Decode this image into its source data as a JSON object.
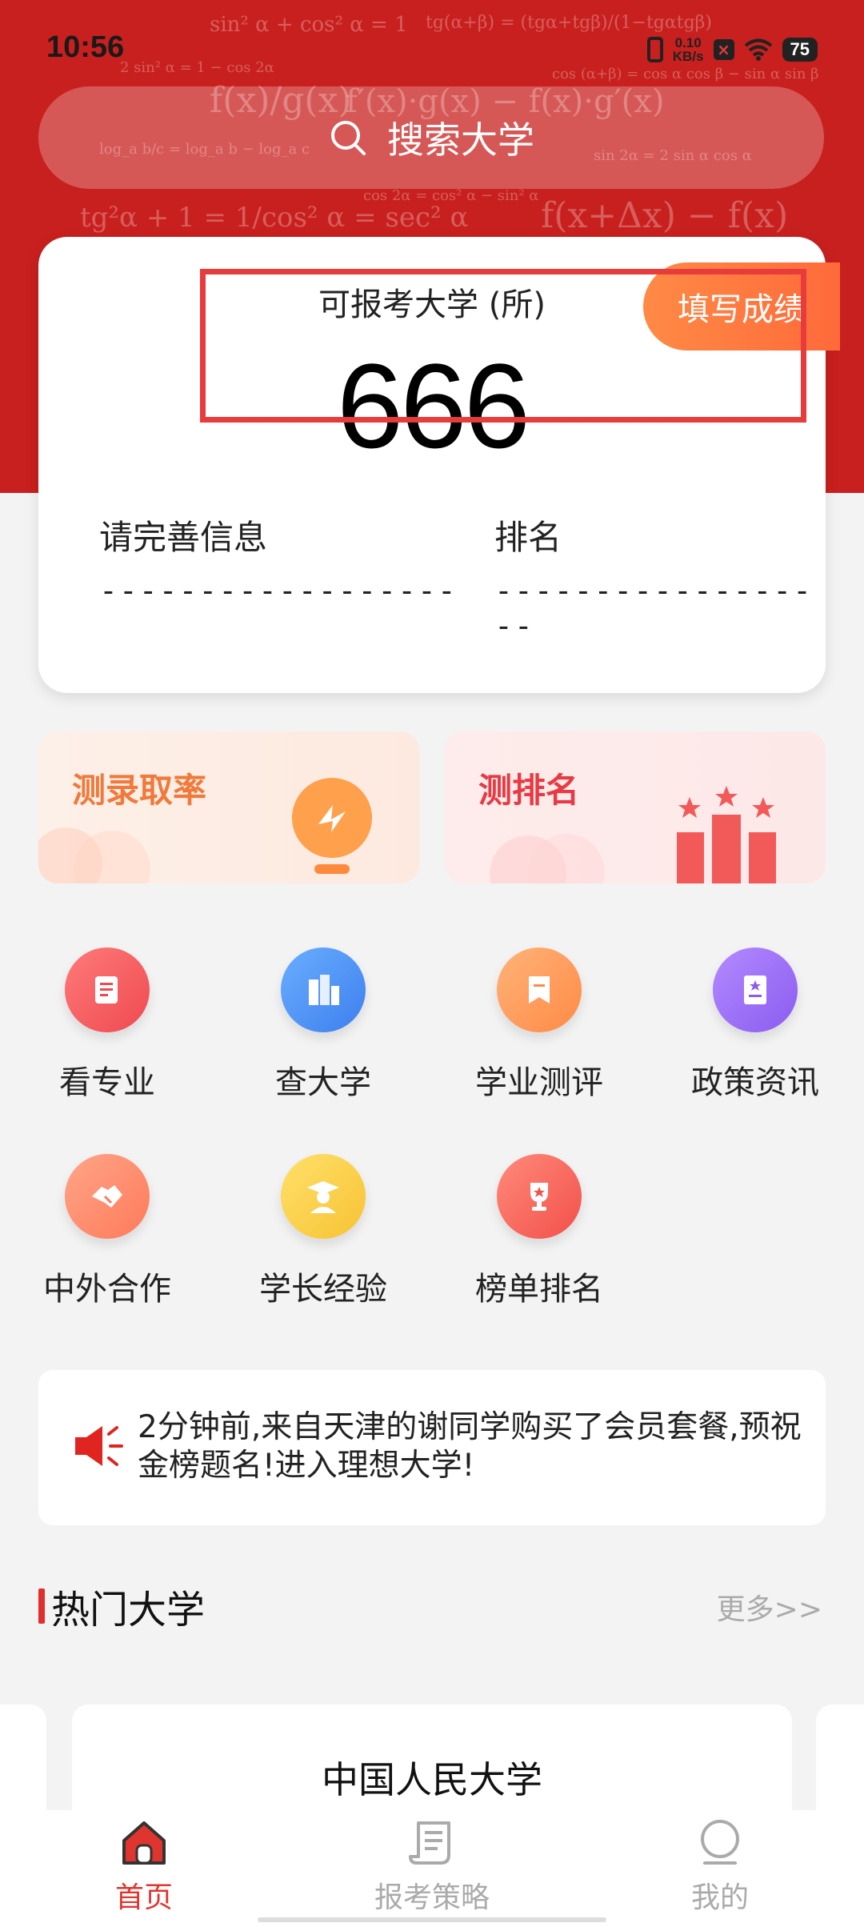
{
  "status_bar": {
    "time": "10:56",
    "net_speed_value": "0.10",
    "net_speed_unit": "KB/s",
    "battery": "75"
  },
  "search": {
    "placeholder": "搜索大学"
  },
  "score_card": {
    "title": "可报考大学 (所)",
    "count": "666",
    "fill_button": "填写成绩",
    "info_left_label": "请完善信息",
    "info_left_value": "------------------",
    "info_right_label": "排名",
    "info_right_value": "------------------"
  },
  "promos": [
    {
      "label": "测录取率",
      "color": "#f07a3c"
    },
    {
      "label": "测排名",
      "color": "#e83a44"
    }
  ],
  "features": [
    {
      "label": "看专业",
      "icon": "document-icon"
    },
    {
      "label": "查大学",
      "icon": "building-icon"
    },
    {
      "label": "学业测评",
      "icon": "bookmark-icon"
    },
    {
      "label": "政策资讯",
      "icon": "book-icon"
    },
    {
      "label": "中外合作",
      "icon": "handshake-icon"
    },
    {
      "label": "学长经验",
      "icon": "graduate-icon"
    },
    {
      "label": "榜单排名",
      "icon": "trophy-icon"
    }
  ],
  "notice": {
    "text": "2分钟前,来自天津的谢同学购买了会员套餐,预祝金榜题名!进入理想大学!"
  },
  "hot_universities": {
    "title": "热门大学",
    "more": "更多>>",
    "items": [
      {
        "name": "中国人民大学"
      }
    ]
  },
  "bottom_nav": [
    {
      "label": "首页",
      "active": true
    },
    {
      "label": "报考策略",
      "active": false
    },
    {
      "label": "我的",
      "active": false
    }
  ],
  "colors": {
    "primary_red": "#c8201e",
    "accent_orange": "#ff7a3d",
    "nav_active": "#e0352f",
    "nav_inactive": "#aaaaaa"
  }
}
